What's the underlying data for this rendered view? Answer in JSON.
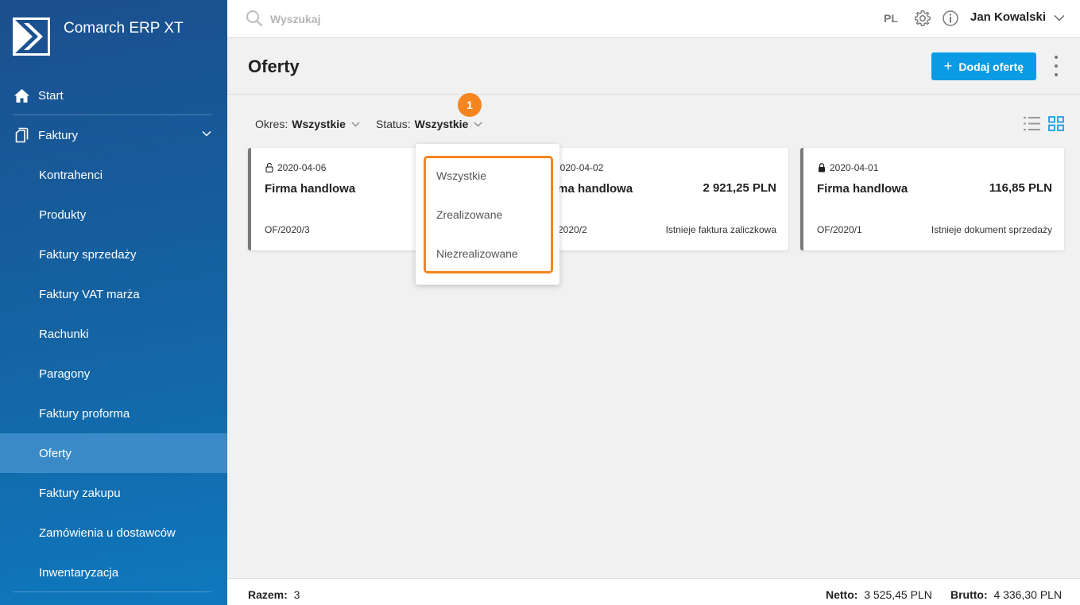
{
  "app": {
    "name": "Comarch ERP XT"
  },
  "search": {
    "placeholder": "Wyszukaj"
  },
  "topbar": {
    "language": "PL",
    "user_name": "Jan Kowalski"
  },
  "sidebar": {
    "items": [
      {
        "label": "Start",
        "icon": "home-icon"
      },
      {
        "label": "Faktury",
        "icon": "documents-icon"
      },
      {
        "label": "Kontrahenci"
      },
      {
        "label": "Produkty"
      },
      {
        "label": "Faktury sprzedaży"
      },
      {
        "label": "Faktury VAT marża"
      },
      {
        "label": "Rachunki"
      },
      {
        "label": "Paragony"
      },
      {
        "label": "Faktury proforma"
      },
      {
        "label": "Oferty",
        "active": true
      },
      {
        "label": "Faktury zakupu"
      },
      {
        "label": "Zamówienia u dostawców"
      },
      {
        "label": "Inwentaryzacja"
      }
    ]
  },
  "page": {
    "title": "Oferty",
    "add_button": "Dodaj ofertę"
  },
  "filters": {
    "period_label": "Okres:",
    "period_value": "Wszystkie",
    "status_label": "Status:",
    "status_value": "Wszystkie",
    "callout_number": "1"
  },
  "status_dropdown": {
    "options": [
      "Wszystkie",
      "Zrealizowane",
      "Niezrealizowane"
    ]
  },
  "cards": [
    {
      "date": "2020-04-06",
      "client": "Firma handlowa",
      "amount": "",
      "number": "OF/2020/3",
      "note": "",
      "locked": false
    },
    {
      "date": "2020-04-02",
      "client": "Firma handlowa",
      "amount": "2 921,25 PLN",
      "number": "OF/2020/2",
      "note": "Istnieje faktura zaliczkowa",
      "locked": false
    },
    {
      "date": "2020-04-01",
      "client": "Firma handlowa",
      "amount": "116,85 PLN",
      "number": "OF/2020/1",
      "note": "Istnieje dokument sprzedaży",
      "locked": true
    }
  ],
  "footer": {
    "count_label": "Razem:",
    "count_value": "3",
    "netto_label": "Netto:",
    "netto_value": "3 525,45 PLN",
    "brutto_label": "Brutto:",
    "brutto_value": "4 336,30 PLN"
  },
  "colors": {
    "accent": "#0b9be5",
    "highlight": "#f5851f",
    "sidebar_active": "#3a8ac7"
  }
}
